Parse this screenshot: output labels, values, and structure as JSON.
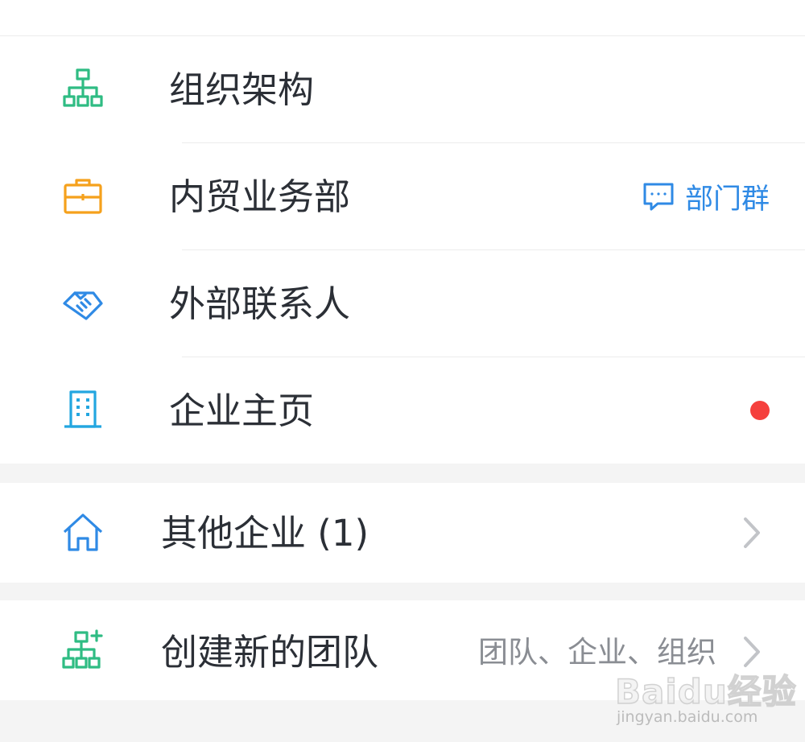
{
  "menu": {
    "items": [
      {
        "label": "组织架构",
        "icon": "org-chart-icon",
        "color": "#2fbc83"
      },
      {
        "label": "内贸业务部",
        "icon": "briefcase-icon",
        "color": "#f5a11c",
        "action_label": "部门群",
        "action_icon": "chat-bubble-icon",
        "action_color": "#2f8ae5"
      },
      {
        "label": "外部联系人",
        "icon": "handshake-icon",
        "color": "#2f8ae5"
      },
      {
        "label": "企业主页",
        "icon": "building-icon",
        "color": "#23a6e0",
        "badge_color": "#f5403d"
      }
    ]
  },
  "other": {
    "label": "其他企业 (1)",
    "icon": "house-icon",
    "color": "#2f8ae5"
  },
  "create": {
    "label": "创建新的团队",
    "hint": "团队、企业、组织",
    "icon": "org-add-icon",
    "color": "#2fbc83"
  },
  "watermark": {
    "main": "Baidu经验",
    "sub": "jingyan.baidu.com"
  }
}
